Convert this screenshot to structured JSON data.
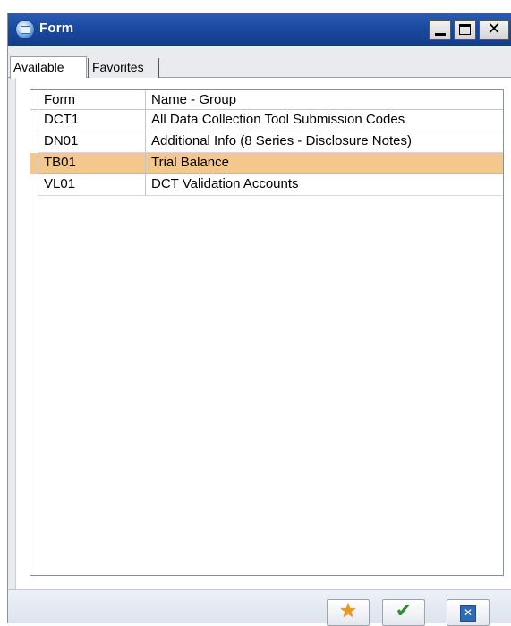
{
  "window": {
    "title": "Form"
  },
  "tabs": [
    {
      "label": "Available",
      "active": true
    },
    {
      "label": "Favorites",
      "active": false
    }
  ],
  "grid": {
    "columns": [
      "Form",
      "Name - Group"
    ],
    "rows": [
      {
        "form": "DCT1",
        "name": "All Data Collection Tool Submission Codes",
        "selected": false
      },
      {
        "form": "DN01",
        "name": "Additional Info (8 Series - Disclosure Notes)",
        "selected": false
      },
      {
        "form": "TB01",
        "name": "Trial Balance",
        "selected": true
      },
      {
        "form": "VL01",
        "name": "DCT Validation Accounts",
        "selected": false
      }
    ]
  },
  "buttons": {
    "favorite_icon": "star-icon",
    "ok_icon": "checkmark-icon",
    "cancel_icon": "close-box-icon"
  },
  "colors": {
    "titlebar": "#1b49a0",
    "selected_row": "#f4c88d"
  }
}
